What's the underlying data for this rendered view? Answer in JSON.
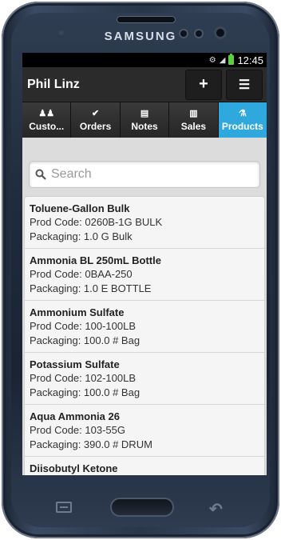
{
  "device": {
    "brand": "SAMSUNG"
  },
  "status_bar": {
    "time": "12:45"
  },
  "header": {
    "title": "Phil Linz",
    "add_label": "+",
    "menu_label": "☰"
  },
  "tabs": [
    {
      "label": "Custo...",
      "icon": "customers-icon",
      "glyph": "♟♟"
    },
    {
      "label": "Orders",
      "icon": "check-icon",
      "glyph": "✔"
    },
    {
      "label": "Notes",
      "icon": "notes-icon",
      "glyph": "▤"
    },
    {
      "label": "Sales",
      "icon": "sales-icon",
      "glyph": "▥"
    },
    {
      "label": "Products",
      "icon": "flask-icon",
      "glyph": "⚗",
      "active": true
    }
  ],
  "search": {
    "placeholder": "Search"
  },
  "products": [
    {
      "name": "Toluene-Gallon Bulk",
      "code": "Prod Code: 0260B-1G BULK",
      "packaging": "Packaging: 1.0 G Bulk"
    },
    {
      "name": "Ammonia BL 250mL Bottle",
      "code": "Prod Code: 0BAA-250",
      "packaging": "Packaging: 1.0 E BOTTLE"
    },
    {
      "name": "Ammonium Sulfate",
      "code": "Prod Code: 100-100LB",
      "packaging": "Packaging: 100.0 # Bag"
    },
    {
      "name": "Potassium Sulfate",
      "code": "Prod Code: 102-100LB",
      "packaging": "Packaging: 100.0 # Bag"
    },
    {
      "name": "Aqua Ammonia 26",
      "code": "Prod Code: 103-55G",
      "packaging": "Packaging: 390.0 # DRUM"
    },
    {
      "name": "Diisobutyl Ketone",
      "code": "",
      "packaging": ""
    }
  ],
  "colors": {
    "active_tab": "#2fa8dd",
    "header_bg": "#2b2b2b",
    "battery": "#5ad13f"
  }
}
